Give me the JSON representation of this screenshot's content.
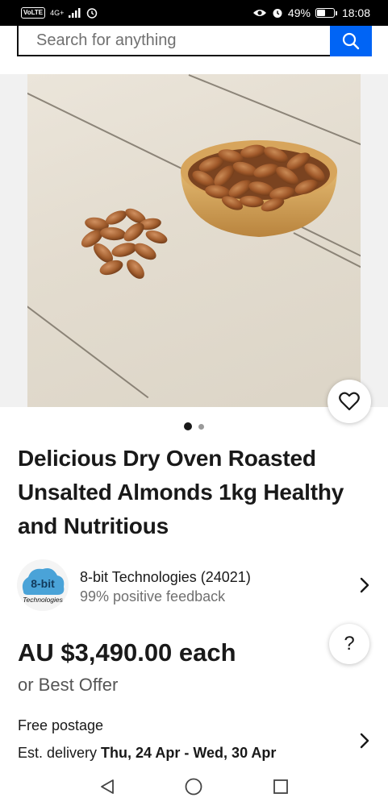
{
  "status_bar": {
    "volte": "VoLTE",
    "network": "4G+",
    "battery": "49%",
    "time": "18:08",
    "icons": [
      "signal-icon",
      "alarm-icon",
      "eye-icon",
      "alarm-clock-icon",
      "battery-icon"
    ]
  },
  "search": {
    "placeholder": "Search for anything",
    "icon": "search-icon"
  },
  "gallery": {
    "favorite_icon": "heart-icon",
    "current_page": 1,
    "total_pages": 2
  },
  "product": {
    "title": "Delicious Dry Oven Roasted Unsalted Almonds 1kg Healthy and Nutritious",
    "price": "AU $3,490.00 each",
    "offer": "or Best Offer"
  },
  "seller": {
    "logo_text_top": "8-bit",
    "logo_text_bottom": "Technologies",
    "name": "8-bit Technologies (24021)",
    "feedback": "99% positive feedback"
  },
  "help": {
    "label": "?"
  },
  "shipping": {
    "postage": "Free postage",
    "delivery_prefix": "Est. delivery ",
    "delivery_dates": "Thu, 24 Apr - Wed, 30 Apr"
  },
  "colors": {
    "accent": "#0064f5",
    "text": "#191919",
    "muted": "#707070"
  },
  "nav_bar": {
    "icons": [
      "back-icon",
      "home-icon",
      "recents-icon"
    ]
  }
}
